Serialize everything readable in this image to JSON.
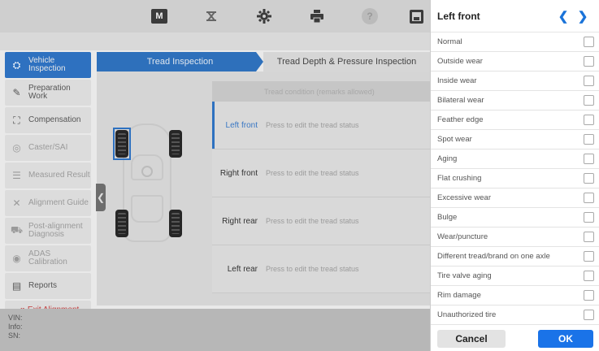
{
  "toolbar": {
    "icons": [
      "home-icon",
      "lift-icon",
      "gear-icon",
      "print-icon",
      "help-icon",
      "save-icon"
    ],
    "home_glyph": "M"
  },
  "sidebar": {
    "items": [
      {
        "label": "Vehicle Inspection",
        "icon": "inspection-icon",
        "state": "active"
      },
      {
        "label": "Preparation Work",
        "icon": "preparation-icon",
        "state": "normal"
      },
      {
        "label": "Compensation",
        "icon": "compensation-icon",
        "state": "normal"
      },
      {
        "label": "Caster/SAI",
        "icon": "caster-icon",
        "state": "dim"
      },
      {
        "label": "Measured Result",
        "icon": "result-icon",
        "state": "dim"
      },
      {
        "label": "Alignment Guide",
        "icon": "guide-icon",
        "state": "dim"
      },
      {
        "label": "Post-alignment Diagnosis",
        "icon": "diagnosis-icon",
        "state": "dim"
      },
      {
        "label": "ADAS Calibration",
        "icon": "adas-icon",
        "state": "dim"
      },
      {
        "label": "Reports",
        "icon": "reports-icon",
        "state": "normal"
      }
    ],
    "exit_label": "Exit Alignment"
  },
  "tabs": [
    {
      "label": "Tread Inspection",
      "active": true
    },
    {
      "label": "Tread Depth & Pressure Inspection",
      "active": false
    }
  ],
  "table": {
    "header": "Tread condition (remarks allowed)",
    "rows": [
      {
        "position": "Left front",
        "value": "Press to edit the tread status",
        "active": true
      },
      {
        "position": "Right front",
        "value": "Press to edit the tread status",
        "active": false
      },
      {
        "position": "Right rear",
        "value": "Press to edit the tread status",
        "active": false
      },
      {
        "position": "Left rear",
        "value": "Press to edit the tread status",
        "active": false
      }
    ]
  },
  "info": {
    "vin_label": "VIN:",
    "info_label": "Info:",
    "sn_label": "SN:"
  },
  "panel": {
    "title": "Left front",
    "options": [
      "Normal",
      "Outside wear",
      "Inside wear",
      "Bilateral wear",
      "Feather edge",
      "Spot wear",
      "Aging",
      "Flat crushing",
      "Excessive wear",
      "Bulge",
      "Wear/puncture",
      "Different tread/brand on one axle",
      "Tire valve aging",
      "Rim damage",
      "Unauthorized tire"
    ],
    "cancel_label": "Cancel",
    "ok_label": "OK"
  },
  "colors": {
    "accent": "#1a73e8",
    "active_tab": "#2e70bb",
    "exit_text": "#c23b3b"
  }
}
